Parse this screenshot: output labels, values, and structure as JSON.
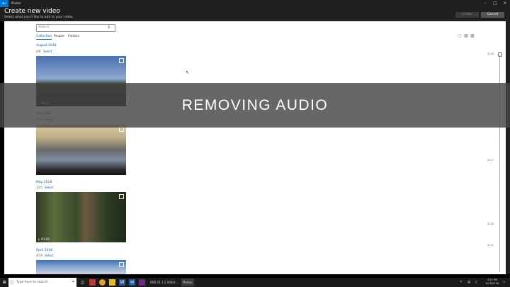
{
  "titlebar": {
    "app_name": "Photos",
    "back_icon": "back-arrow-icon",
    "controls": [
      "minimize-icon",
      "maximize-icon",
      "close-icon"
    ]
  },
  "header": {
    "title": "Create new video",
    "subtitle": "Select what you'd like to add to your video.",
    "create_label": "Create",
    "cancel_label": "Cancel"
  },
  "search": {
    "placeholder": "Search"
  },
  "tabs": [
    {
      "label": "Collection",
      "active": true
    },
    {
      "label": "People",
      "active": false
    },
    {
      "label": "Folders",
      "active": false
    }
  ],
  "groups": [
    {
      "month": "August 2018",
      "count": "0/8",
      "select": "Select",
      "duration": "00:17"
    },
    {
      "month": "July 2018",
      "count": "7/13",
      "select": "Select",
      "duration": ""
    },
    {
      "month": "May 2018",
      "count": "1/25",
      "select": "Select",
      "duration": "01:00"
    },
    {
      "month": "April 2018",
      "count": "4/19",
      "select": "Select",
      "duration": ""
    }
  ],
  "timeline": {
    "years": [
      "2018",
      "2017",
      "2016",
      "2015"
    ]
  },
  "overlay": {
    "text": "REMOVING AUDIO"
  },
  "taskbar": {
    "search_placeholder": "Type here to search",
    "windows": [
      "OBS 21.1.2 (64bit...",
      "Photos"
    ],
    "clock_time": "3:57 PM",
    "clock_date": "8/15/2018"
  },
  "colors": {
    "accent": "#0063b1",
    "chrome": "#1f1f1f",
    "overlay": "#464646"
  }
}
